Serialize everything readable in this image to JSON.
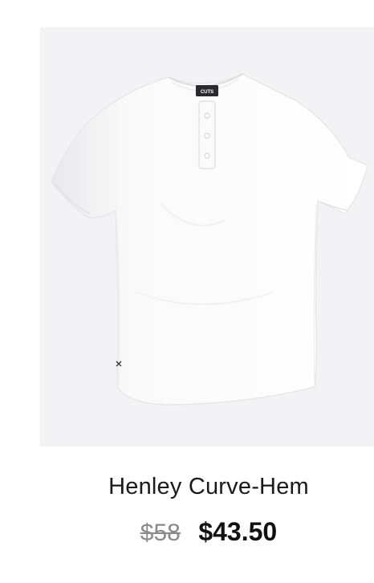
{
  "product": {
    "name": "Henley Curve-Hem",
    "original_price": "$58",
    "sale_price": "$43.50",
    "label_text": "CUTS",
    "image_background": "#f3f3f5",
    "shirt_color": "#ffffff"
  }
}
